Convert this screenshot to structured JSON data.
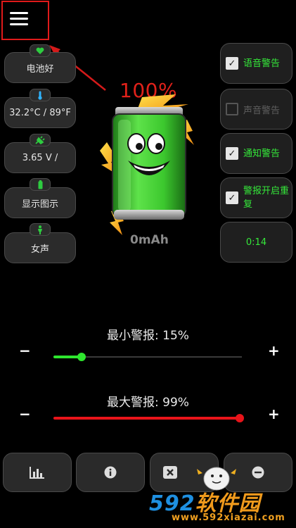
{
  "header": {
    "menu_icon": "hamburger-menu-icon"
  },
  "status": {
    "health": {
      "icon": "heart-icon",
      "label": "电池好"
    },
    "temperature": {
      "icon": "thermometer-icon",
      "label": "32.2°C / 89°F"
    },
    "voltage": {
      "icon": "plug-icon",
      "label": "3.65 V /"
    },
    "display": {
      "icon": "battery-small-icon",
      "label": "显示图示"
    },
    "voice": {
      "icon": "person-icon",
      "label": "女声"
    }
  },
  "options": {
    "voice_alert": {
      "label": "语音警告",
      "checked": true
    },
    "sound_alert": {
      "label": "声音警告",
      "checked": false
    },
    "notify_alert": {
      "label": "通知警告",
      "checked": true
    },
    "repeat_alert": {
      "label": "警报开启重复",
      "checked": true
    },
    "timer": "0:14"
  },
  "battery": {
    "percent": "100%",
    "capacity": "0mAh",
    "level": 1.0
  },
  "sliders": {
    "min": {
      "label": "最小警报: 15%",
      "value": 15,
      "color": "#2ee62e",
      "minus": "−",
      "plus": "+"
    },
    "max": {
      "label": "最大警报: 99%",
      "value": 99,
      "color": "#e8141a",
      "minus": "−",
      "plus": "+"
    }
  },
  "bottom": {
    "stats_icon": "bar-chart-icon",
    "info_icon": "info-icon",
    "close_icon": "close-icon",
    "minus_icon": "minus-circle-icon"
  },
  "watermark": {
    "brand_num": "592",
    "brand_cn": "软件园",
    "url": "www.592xiazai.com"
  },
  "colors": {
    "accent_green": "#35e83a",
    "alert_red": "#e0211a"
  }
}
